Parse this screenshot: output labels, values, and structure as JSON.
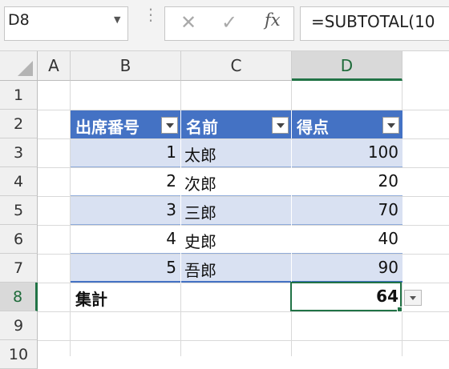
{
  "name_box": {
    "value": "D8"
  },
  "formula_bar": {
    "formula": "=SUBTOTAL(10",
    "fx_label": "fx",
    "cancel_glyph": "✕",
    "enter_glyph": "✓",
    "divider_glyph": "⋮"
  },
  "columns": [
    "A",
    "B",
    "C",
    "D"
  ],
  "rows": [
    "1",
    "2",
    "3",
    "4",
    "5",
    "6",
    "7",
    "8",
    "9",
    "10"
  ],
  "selected_cell": {
    "column": "D",
    "row": "8"
  },
  "table": {
    "headers": [
      "出席番号",
      "名前",
      "得点"
    ],
    "rows": [
      {
        "no": "1",
        "name": "太郎",
        "score": "100"
      },
      {
        "no": "2",
        "name": "次郎",
        "score": "20"
      },
      {
        "no": "3",
        "name": "三郎",
        "score": "70"
      },
      {
        "no": "4",
        "name": "史郎",
        "score": "40"
      },
      {
        "no": "5",
        "name": "吾郎",
        "score": "90"
      }
    ],
    "total_label": "集計",
    "total_value": "64",
    "header_color": "#4472c4",
    "band_color": "#d9e1f2"
  }
}
